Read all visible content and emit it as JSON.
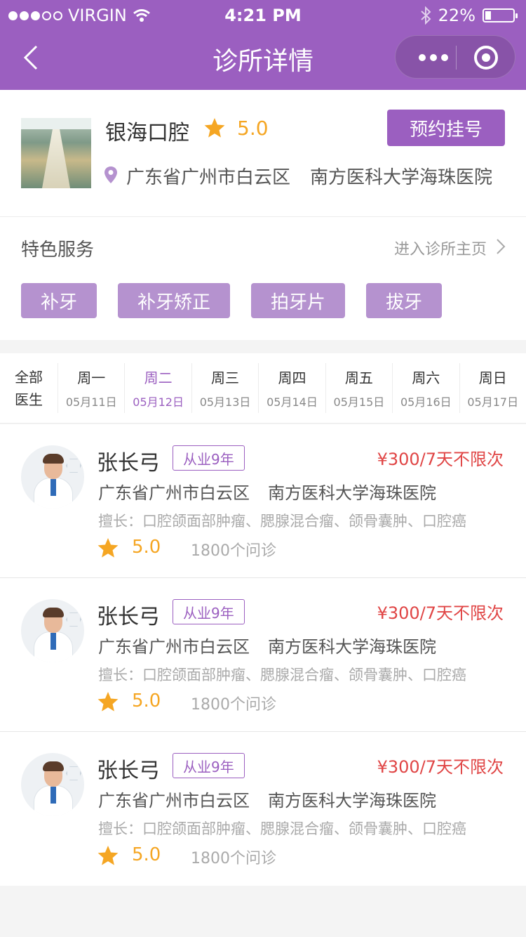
{
  "status_bar": {
    "carrier": "VIRGIN",
    "time": "4:21 PM",
    "battery": "22%",
    "battery_level": 0.22,
    "signal_bars_filled": 3,
    "signal_bars_total": 5
  },
  "nav": {
    "title": "诊所详情"
  },
  "clinic": {
    "name": "银海口腔",
    "rating": "5.0",
    "book_label": "预约挂号",
    "region": "广东省广州市白云区",
    "hospital": "南方医科大学海珠医院"
  },
  "services": {
    "title": "特色服务",
    "link_label": "进入诊所主页",
    "tags": [
      "补牙",
      "补牙矫正",
      "拍牙片",
      "拔牙"
    ]
  },
  "schedule": {
    "all_line1": "全部",
    "all_line2": "医生",
    "days": [
      {
        "weekday": "周一",
        "date": "05月11日"
      },
      {
        "weekday": "周二",
        "date": "05月12日"
      },
      {
        "weekday": "周三",
        "date": "05月13日"
      },
      {
        "weekday": "周四",
        "date": "05月14日"
      },
      {
        "weekday": "周五",
        "date": "05月15日"
      },
      {
        "weekday": "周六",
        "date": "05月16日"
      },
      {
        "weekday": "周日",
        "date": "05月17日"
      }
    ],
    "selected_index": 1
  },
  "doctors": [
    {
      "name": "张长弓",
      "years": "从业9年",
      "price": "¥300/7天不限次",
      "region": "广东省广州市白云区",
      "hospital": "南方医科大学海珠医院",
      "skills": "擅长：口腔颌面部肿瘤、腮腺混合瘤、颌骨囊肿、口腔癌",
      "rating": "5.0",
      "consults": "1800个问诊"
    },
    {
      "name": "张长弓",
      "years": "从业9年",
      "price": "¥300/7天不限次",
      "region": "广东省广州市白云区",
      "hospital": "南方医科大学海珠医院",
      "skills": "擅长：口腔颌面部肿瘤、腮腺混合瘤、颌骨囊肿、口腔癌",
      "rating": "5.0",
      "consults": "1800个问诊"
    },
    {
      "name": "张长弓",
      "years": "从业9年",
      "price": "¥300/7天不限次",
      "region": "广东省广州市白云区",
      "hospital": "南方医科大学海珠医院",
      "skills": "擅长：口腔颌面部肿瘤、腮腺混合瘤、颌骨囊肿、口腔癌",
      "rating": "5.0",
      "consults": "1800个问诊"
    }
  ],
  "colors": {
    "primary": "#9b5fc0",
    "tag": "#b592cf",
    "star": "#f5a623",
    "price": "#e04545"
  },
  "icons": {
    "back": "chevron-left-icon",
    "more": "more-dots-icon",
    "close": "target-circle-icon",
    "star": "star-icon",
    "location": "location-pin-icon",
    "forward": "chevron-right-icon"
  }
}
